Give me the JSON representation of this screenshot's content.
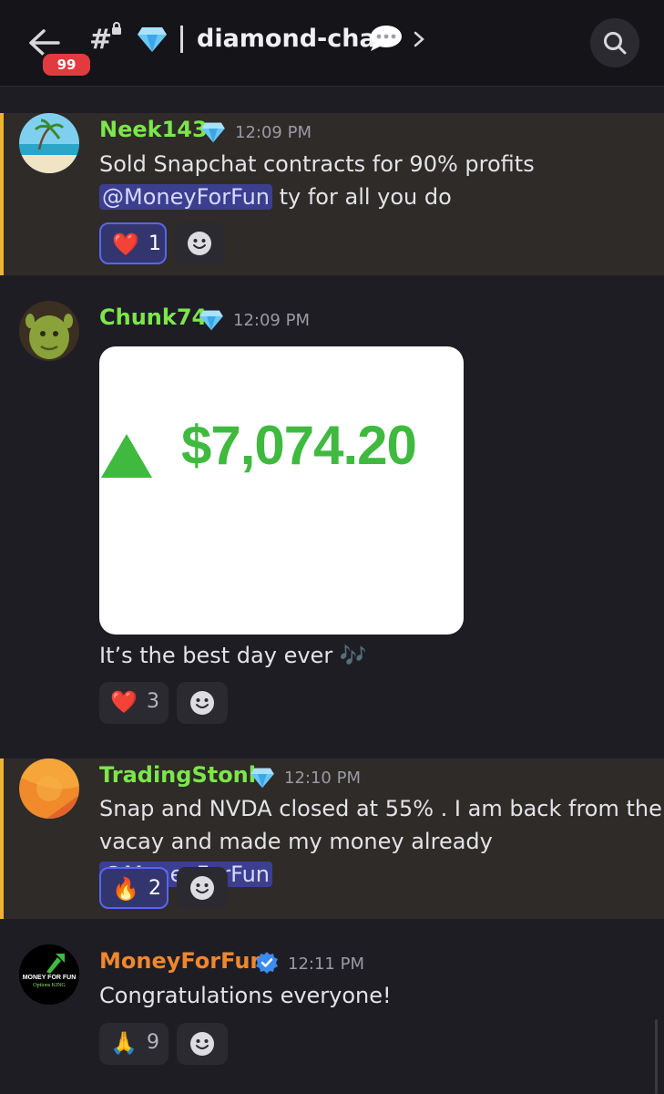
{
  "header": {
    "unread_badge": "99",
    "channel_name": "diamond-chat",
    "back_icon": "arrow-left-icon",
    "search_icon": "search-icon"
  },
  "messages": [
    {
      "username": "Neek143",
      "username_color": "#7ce64a",
      "time": "12:09 PM",
      "text": "Sold Snapchat contracts for 90% profits",
      "mention": "@MoneyForFun",
      "text_after": " ty for all you do",
      "highlighted": true,
      "reaction": {
        "emoji": "❤️",
        "count": "1",
        "active": true
      }
    },
    {
      "username": "Chunk74",
      "username_color": "#7ce64a",
      "time": "12:09 PM",
      "image": {
        "amount": "$7,074.20"
      },
      "text": "It’s the best day ever 🎶",
      "highlighted": false,
      "reaction": {
        "emoji": "❤️",
        "count": "3",
        "active": false
      }
    },
    {
      "username": "TradingStonk",
      "username_color": "#7ce64a",
      "time": "12:10 PM",
      "text_line1": "Snap and NVDA closed at 55% . I am back from the",
      "text_line2": "vacay and made my money already",
      "mention": "@MoneyForFun",
      "highlighted": true,
      "reaction": {
        "emoji": "🔥",
        "count": "2",
        "active": true
      }
    },
    {
      "username": "MoneyForFun",
      "username_color": "#f0872e",
      "time": "12:11 PM",
      "avatar_text1": "MONEY FOR FUN",
      "avatar_text2": "Options KING",
      "text": "Congratulations everyone!",
      "highlighted": false,
      "reaction": {
        "emoji": "🙏",
        "count": "9",
        "active": false
      }
    }
  ],
  "colors": {
    "accent": "#5865f2",
    "highlight_bar": "#f0b232",
    "gain_green": "#3fba3f"
  }
}
